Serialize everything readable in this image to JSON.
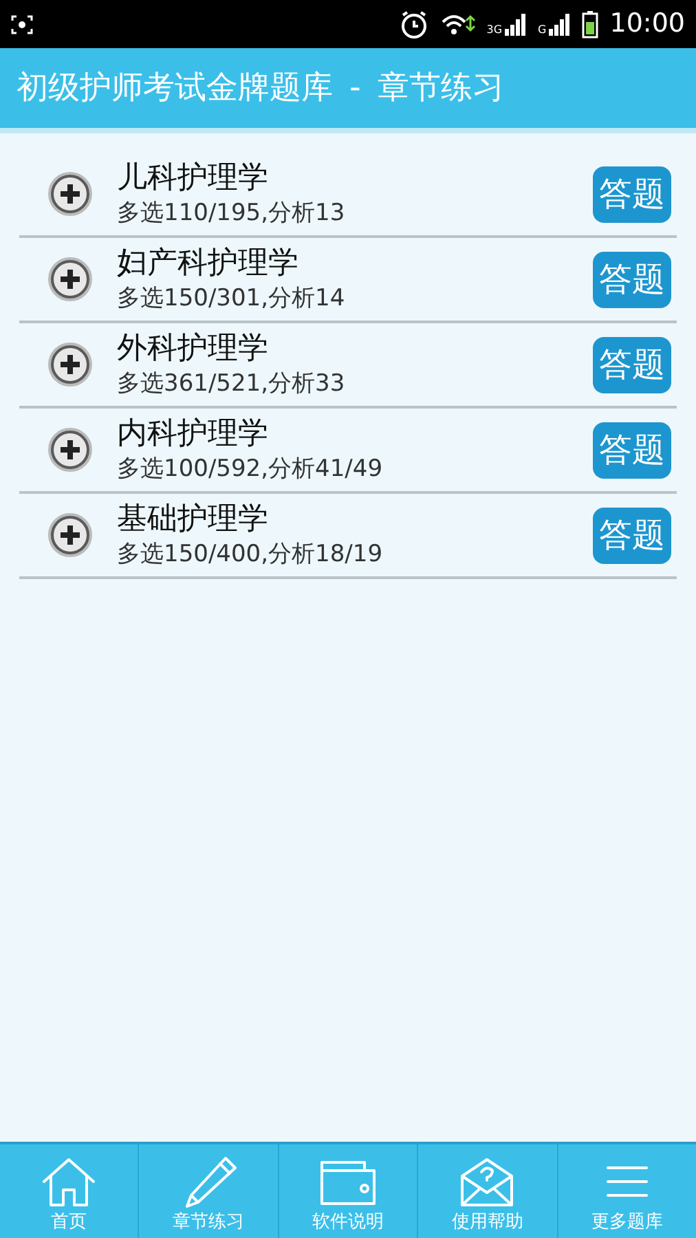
{
  "status_bar": {
    "time": "10:00",
    "network_1": "3G",
    "network_2": "G"
  },
  "header": {
    "title": "初级护师考试金牌题库",
    "separator": "-",
    "subtitle": "章节练习"
  },
  "chapters": [
    {
      "title": "儿科护理学",
      "stats": "多选110/195,分析13",
      "button": "答题"
    },
    {
      "title": "妇产科护理学",
      "stats": "多选150/301,分析14",
      "button": "答题"
    },
    {
      "title": "外科护理学",
      "stats": "多选361/521,分析33",
      "button": "答题"
    },
    {
      "title": "内科护理学",
      "stats": "多选100/592,分析41/49",
      "button": "答题"
    },
    {
      "title": "基础护理学",
      "stats": "多选150/400,分析18/19",
      "button": "答题"
    }
  ],
  "tab_bar": [
    {
      "kind": "home",
      "label": "首页"
    },
    {
      "kind": "pen",
      "label": "章节练习"
    },
    {
      "kind": "wallet",
      "label": "软件说明"
    },
    {
      "kind": "mail",
      "label": "使用帮助"
    },
    {
      "kind": "more",
      "label": "更多题库"
    }
  ]
}
